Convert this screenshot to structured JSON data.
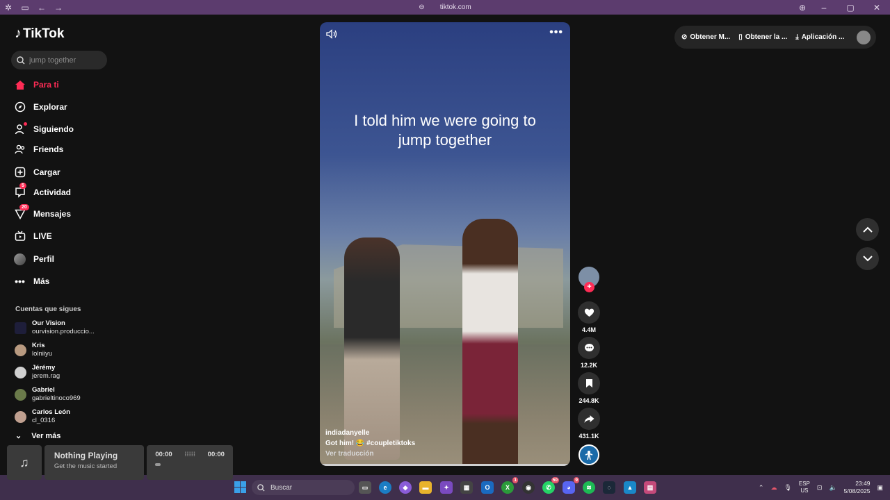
{
  "browser": {
    "url": "tiktok.com"
  },
  "sidebar": {
    "logo": "TikTok",
    "search_placeholder": "jump together",
    "nav": [
      {
        "label": "Para ti",
        "badge": ""
      },
      {
        "label": "Explorar",
        "badge": ""
      },
      {
        "label": "Siguiendo",
        "badge": ""
      },
      {
        "label": "Friends",
        "badge": ""
      },
      {
        "label": "Cargar",
        "badge": ""
      },
      {
        "label": "Actividad",
        "badge": "5"
      },
      {
        "label": "Mensajes",
        "badge": "20"
      },
      {
        "label": "LIVE",
        "badge": ""
      },
      {
        "label": "Perfil",
        "badge": ""
      },
      {
        "label": "Más",
        "badge": ""
      }
    ],
    "following_title": "Cuentas que sigues",
    "following": [
      {
        "name": "Our Vision",
        "handle": "ourvision.produccio..."
      },
      {
        "name": "Kris",
        "handle": "lolniiyu"
      },
      {
        "name": "Jérémy",
        "handle": "jerem.rag"
      },
      {
        "name": "Gabriel",
        "handle": "gabrieltinoco969"
      },
      {
        "name": "Carlos León",
        "handle": "cl_0316"
      }
    ],
    "see_more": "Ver más"
  },
  "video": {
    "overlay_text": "I told him we were going to jump together",
    "username": "indiadanyelle",
    "description": "Got him! 😂 #coupletiktoks",
    "translate": "Ver traducción"
  },
  "actions": {
    "likes": "4.4M",
    "comments": "12.2K",
    "saves": "244.8K",
    "shares": "431.1K"
  },
  "topbar": {
    "coins": "Obtener M...",
    "app": "Obtener la ...",
    "desktop": "Aplicación ..."
  },
  "music_widget": {
    "title": "Nothing Playing",
    "subtitle": "Get the music started",
    "time_start": "00:00",
    "time_end": "00:00"
  },
  "taskbar": {
    "search": "Buscar",
    "lang_top": "ESP",
    "lang_bottom": "US",
    "time": "23:49",
    "date": "5/08/2025",
    "badges": {
      "xbox": "1",
      "whatsapp": "50",
      "discord": "9"
    }
  },
  "colors": {
    "accent": "#fe2c55",
    "chrome": "#5c3c6e",
    "taskbar": "#3f2f4c"
  }
}
